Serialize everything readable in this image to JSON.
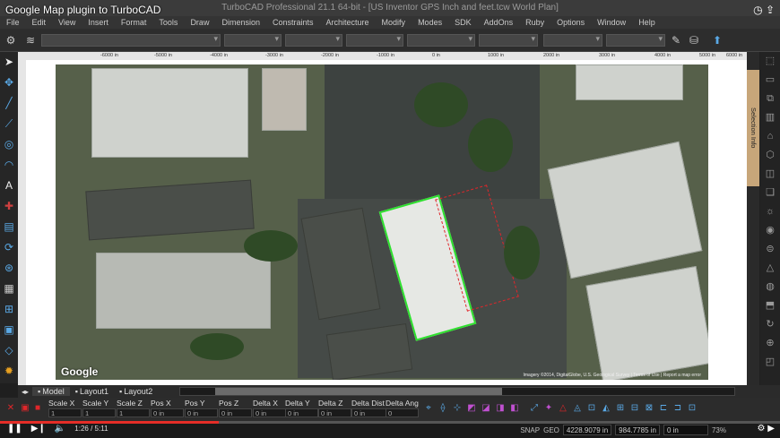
{
  "video": {
    "title": "Google Map plugin to TurboCAD",
    "timecode": "1:26 / 5:11",
    "progress": 0.28
  },
  "window": {
    "title": "TurboCAD Professional 21.1 64-bit - [US Inventor GPS Inch and feet.tcw World Plan]"
  },
  "menu": [
    "File",
    "Edit",
    "View",
    "Insert",
    "Format",
    "Tools",
    "Draw",
    "Dimension",
    "Constraints",
    "Architecture",
    "Modify",
    "Modes",
    "SDK",
    "AddOns",
    "Ruby",
    "Options",
    "Window",
    "Help"
  ],
  "ruler_ticks": [
    "-6000 in",
    "-5000 in",
    "-4000 in",
    "-3000 in",
    "-2000 in",
    "-1000 in",
    "0 in",
    "1000 in",
    "2000 in",
    "3000 in",
    "4000 in",
    "5000 in",
    "6000 in"
  ],
  "tabs": [
    "Model",
    "Layout1",
    "Layout2"
  ],
  "side_panel": {
    "label": "Selection Info"
  },
  "inspector": {
    "fields": [
      {
        "label": "Scale X",
        "value": "1"
      },
      {
        "label": "Scale Y",
        "value": "1"
      },
      {
        "label": "Scale Z",
        "value": "1"
      },
      {
        "label": "Pos X",
        "value": "0 in"
      },
      {
        "label": "Pos Y",
        "value": "0 in"
      },
      {
        "label": "Pos Z",
        "value": "0 in"
      },
      {
        "label": "Delta X",
        "value": "0 in"
      },
      {
        "label": "Delta Y",
        "value": "0 in"
      },
      {
        "label": "Delta Z",
        "value": "0 in"
      },
      {
        "label": "Delta Dist",
        "value": "0 in"
      },
      {
        "label": "Delta Ang",
        "value": "0"
      }
    ]
  },
  "status": {
    "snap": "SNAP",
    "geo": "GEO",
    "x": "4228.9079 in",
    "y": "984.7785 in",
    "z": "0 in",
    "zoom": "73%"
  },
  "map": {
    "logo": "Google",
    "imagery": "Imagery ©2014, DigitalGlobe, U.S. Geological Survey | Terms of Use | Report a map error"
  },
  "colors": {
    "accent": "#5aa9e6",
    "selection": "#2ee02e",
    "markup": "#e0262a",
    "progress": "#e52d27"
  }
}
